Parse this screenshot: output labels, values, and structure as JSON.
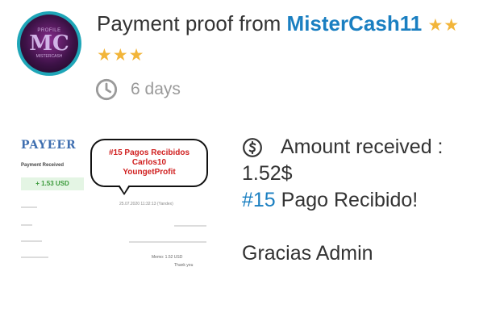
{
  "post": {
    "title_prefix": "Payment proof from ",
    "username": "MisterCash11",
    "stars": "★★★★★",
    "stars_line1": "★★",
    "stars_line2": "★★★",
    "time_ago": "6 days",
    "avatar": {
      "top_text": "PROFILE",
      "monogram": "MC",
      "bottom_text": "MISTERCASH"
    }
  },
  "proof_image": {
    "brand": "PAYEER",
    "received_label": "Payment Received",
    "amount": "+ 1.53 USD",
    "date": "25.07.2020 11:32:13 (Yandex)",
    "memo": "Memo: 1.52 USD",
    "thanks": "Thank you",
    "annotation": {
      "line1": "#15 Pagos Recibidos",
      "line2": "Carlos10",
      "line3": "YoungetProfit"
    }
  },
  "details": {
    "amount_label": "Amount received :",
    "amount_value": "1.52$",
    "tag": "#15",
    "message": " Pago Recibido!",
    "closing": "Gracias Admin"
  },
  "colors": {
    "link": "#1a7fc1",
    "star": "#f2b53a",
    "muted": "#9a9a9a",
    "avatar_ring": "#1fa6b8"
  },
  "icons": {
    "time": "clock-icon",
    "amount": "dollar-circle-icon"
  }
}
